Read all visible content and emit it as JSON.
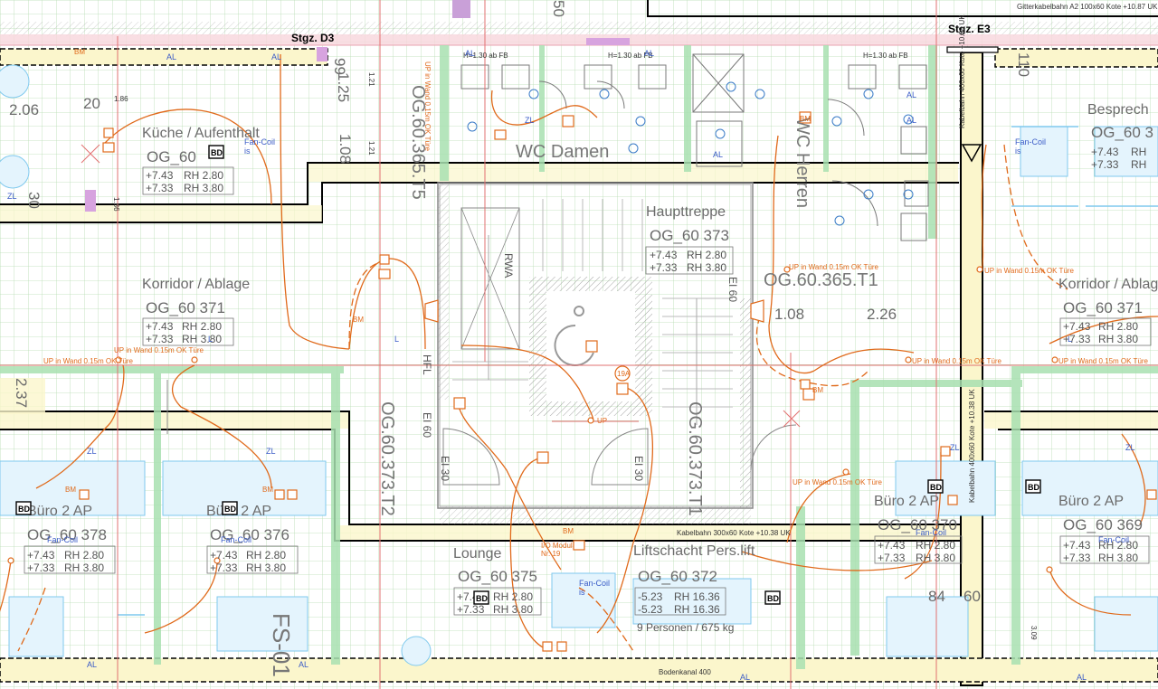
{
  "header": {
    "cable_tray_a2": "Gitterkabelbahn A2 100x60 Kote +10.87 UK",
    "stair_d3": "Stgz. D3",
    "stair_e3": "Stgz. E3",
    "cable_tray_vertical_top": "Kabelbahn 400x60 Kote +10.68 UK",
    "cable_tray_vertical_right": "Kabelbahn 400x60 Kote +10.38 UK",
    "cable_tray_horizontal": "Kabelbahn 300x60 Kote +10.38 UK",
    "floor_channel": "Bodenkanal 400"
  },
  "rooms": {
    "kueche": {
      "name": "Küche / Aufenthalt",
      "id": "OG_60",
      "lvl1": "+7.43",
      "rh1": "RH 2.80",
      "lvl2": "+7.33",
      "rh2": "RH 3.80"
    },
    "korridor_left": {
      "name": "Korridor / Ablage",
      "id": "OG_60 371",
      "lvl1": "+7.43",
      "rh1": "RH 2.80",
      "lvl2": "+7.33",
      "rh2": "RH 3.80"
    },
    "haupttreppe": {
      "name": "Haupttreppe",
      "id": "OG_60 373",
      "lvl1": "+7.43",
      "rh1": "RH 2.80",
      "lvl2": "+7.33",
      "rh2": "RH 3.80"
    },
    "besprechung": {
      "name": "Besprech",
      "id": "OG_60 3",
      "lvl1": "+7.43",
      "rh1": "RH",
      "lvl2": "+7.33",
      "rh2": "RH"
    },
    "korridor_right": {
      "name": "Korridor / Ablag",
      "id": "OG_60 371",
      "lvl1": "+7.43",
      "rh1": "RH 2.80",
      "lvl2": "+7.33",
      "rh2": "RH 3.80"
    },
    "buero378": {
      "name": "Büro 2 AP",
      "id": "OG_60 378",
      "lvl1": "+7.43",
      "rh1": "RH 2.80",
      "lvl2": "+7.33",
      "rh2": "RH 3.80"
    },
    "buero376": {
      "name": "Büro 2 AP",
      "id": "OG_60 376",
      "lvl1": "+7.43",
      "rh1": "RH 2.80",
      "lvl2": "+7.33",
      "rh2": "RH 3.80"
    },
    "lounge": {
      "name": "Lounge",
      "id": "OG_60 375",
      "lvl1": "+7.43",
      "rh1": "RH 2.80",
      "lvl2": "+7.33",
      "rh2": "RH 3.80"
    },
    "liftschacht": {
      "name": "Liftschacht Pers.lift",
      "id": "OG_60 372",
      "lvl1": "-5.23",
      "rh1": "RH 16.36",
      "lvl2": "-5.23",
      "rh2": "RH 16.36",
      "note": "9 Personen / 675 kg"
    },
    "buero370": {
      "name": "Büro 2 AP",
      "id": "OG_60 370",
      "lvl1": "+7.43",
      "rh1": "RH 2.80",
      "lvl2": "+7.33",
      "rh2": "RH 3.80"
    },
    "buero369": {
      "name": "Büro 2 AP",
      "id": "OG_60 369",
      "lvl1": "+7.43",
      "rh1": "RH 2.80",
      "lvl2": "+7.33",
      "rh2": "RH 3.80"
    }
  },
  "labels": {
    "wc_damen": "WC Damen",
    "wc_herren": "WC Herren",
    "og_365_t5": "OG.60.365.T5",
    "og_365_t1": "OG.60.365.T1",
    "og_373_t2": "OG.60.373.T2",
    "og_373_t1": "OG.60.373.T1",
    "fs": "FS-01",
    "rwa": "RWA",
    "hfl": "HFL",
    "ei60_a": "EI 60",
    "ei60_b": "EI 60",
    "ei30_a": "EI 30",
    "ei30_b": "EI 30",
    "dim_206": "2.06",
    "dim_20": "20",
    "dim_30": "30",
    "dim_125": "1.25",
    "dim_108_v": "1.08",
    "dim_108_h": "1.08",
    "dim_226": "2.26",
    "dim_84": "84",
    "dim_60": "60",
    "dim_237": "2.37",
    "dim_186a": "1.86",
    "dim_186b": "1.86",
    "dim_121a": "1.21",
    "dim_121b": "1.21",
    "dim_309": "3.09",
    "dim_99": "99",
    "dim_110": "110",
    "dim_50": "50",
    "h130_a": "H=1.30 ab FB",
    "h130_b": "H=1.30 ab FB",
    "h130_c": "H=1.30 ab FB",
    "up_wand_a": "UP in Wand 0.15m OK Türe",
    "up_wand_b": "UP in Wand 0.15m OK Türe",
    "up_wand_c": "UP in Wand 0.15m OK Türe",
    "up_wand_d": "UP in Wand 0.15m OK Türe",
    "up_wand_e": "UP in Wand 0.15m OK Türe",
    "up_wand_f": "UP in Wand 0.15m OK Türe",
    "up_wand_g": "UP in Wand 0.15m OK Türe",
    "up": "UP",
    "io_modul": "I/O Modul",
    "io_nr": "Nr. 19",
    "r19a": "19A",
    "fancoil": "Fan-Coil",
    "fancoil_is": "is",
    "bd": "BD",
    "bm": "BM",
    "zl": "ZL",
    "al": "AL",
    "l": "L",
    "2ap_a": "2 AP",
    "bue_a": "Bü"
  },
  "colors": {
    "grid": "#a9d8a5",
    "wall_green": "#a8e0b0",
    "tray_fill": "#fbf6cc",
    "orange": "#e06a1b",
    "red": "#e05050",
    "blue_fixture": "#7fc9ee"
  }
}
